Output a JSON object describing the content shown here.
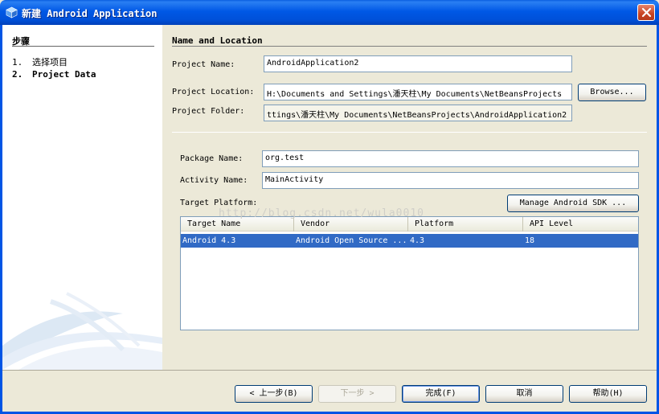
{
  "window": {
    "title": "新建 Android Application"
  },
  "steps": {
    "title": "步骤",
    "items": [
      {
        "num": "1.",
        "label": "选择项目"
      },
      {
        "num": "2.",
        "label": "Project Data"
      }
    ]
  },
  "section": {
    "title": "Name and Location"
  },
  "project": {
    "name_label": "Project Name:",
    "name_value": "AndroidApplication2",
    "location_label": "Project Location:",
    "location_value": "H:\\Documents and Settings\\潘天柱\\My Documents\\NetBeansProjects",
    "browse_label": "Browse...",
    "folder_label": "Project Folder:",
    "folder_value": "ttings\\潘天柱\\My Documents\\NetBeansProjects\\AndroidApplication2"
  },
  "package": {
    "package_label": "Package Name:",
    "package_value": "org.test",
    "activity_label": "Activity Name:",
    "activity_value": "MainActivity",
    "platform_label": "Target Platform:",
    "manage_sdk_label": "Manage Android SDK ..."
  },
  "table": {
    "columns": [
      "Target Name",
      "Vendor",
      "Platform",
      "API Level"
    ],
    "rows": [
      [
        "Android 4.3",
        "Android Open Source ...",
        "4.3",
        "18"
      ]
    ]
  },
  "watermark": "http://blog.csdn.net/wula0010",
  "buttons": {
    "back": "< 上一步(B)",
    "next": "下一步 >",
    "finish": "完成(F)",
    "cancel": "取消",
    "help": "帮助(H)"
  },
  "colors": {
    "titlebar": "#0058E6",
    "selection": "#316AC5",
    "dialog_bg": "#ECE9D8"
  }
}
